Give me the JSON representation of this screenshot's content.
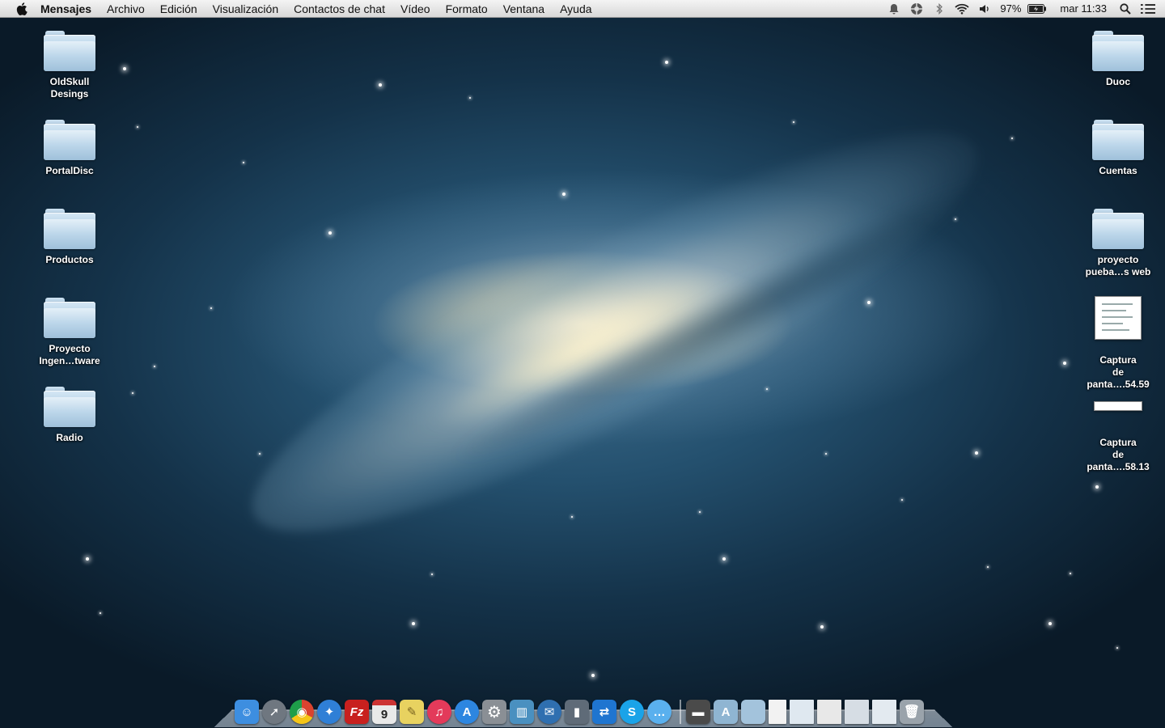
{
  "menubar": {
    "apple_icon": "apple-icon",
    "app_name": "Mensajes",
    "menus": [
      "Archivo",
      "Edición",
      "Visualización",
      "Contactos de chat",
      "Vídeo",
      "Formato",
      "Ventana",
      "Ayuda"
    ],
    "status": {
      "battery_percent": "97%",
      "clock": "mar 11:33"
    }
  },
  "desktop": {
    "left_icons": [
      {
        "label": "OldSkull Desings",
        "type": "folder"
      },
      {
        "label": "PortalDisc",
        "type": "folder"
      },
      {
        "label": "Productos",
        "type": "folder"
      },
      {
        "label": "Proyecto Ingen…tware",
        "type": "folder"
      },
      {
        "label": "Radio",
        "type": "folder"
      }
    ],
    "right_icons": [
      {
        "label": "Duoc",
        "type": "folder"
      },
      {
        "label": "Cuentas",
        "type": "folder"
      },
      {
        "label": "proyecto pueba…s web",
        "type": "folder"
      },
      {
        "label": "Captura de panta….54.59",
        "type": "screenshot"
      },
      {
        "label": "Captura de panta….58.13",
        "type": "screenshot"
      }
    ]
  },
  "dock": {
    "apps": [
      {
        "icon": "finder-icon",
        "glyph": "☺",
        "color": "#3d8ee0"
      },
      {
        "icon": "launchpad-icon",
        "glyph": "➚",
        "color": "#6f7780"
      },
      {
        "icon": "chrome-icon",
        "glyph": "◉",
        "color": "#d9432f"
      },
      {
        "icon": "safari-icon",
        "glyph": "✦",
        "color": "#2f7fd6"
      },
      {
        "icon": "filezilla-icon",
        "glyph": "Fz",
        "color": "#c8201e"
      },
      {
        "icon": "calendar-icon",
        "glyph": "9",
        "color": "#e9e9e9"
      },
      {
        "icon": "stickies-icon",
        "glyph": "✎",
        "color": "#e8d260"
      },
      {
        "icon": "itunes-icon",
        "glyph": "♫",
        "color": "#e33a5a"
      },
      {
        "icon": "app-store-icon",
        "glyph": "A",
        "color": "#2d86e0"
      },
      {
        "icon": "system-preferences-icon",
        "glyph": "⚙",
        "color": "#8a8f95"
      },
      {
        "icon": "sketch-icon",
        "glyph": "▥",
        "color": "#4a90c0"
      },
      {
        "icon": "thunderbird-icon",
        "glyph": "✉",
        "color": "#2f6fb0"
      },
      {
        "icon": "barcode-icon",
        "glyph": "▮",
        "color": "#5f6b78"
      },
      {
        "icon": "teamviewer-icon",
        "glyph": "⇄",
        "color": "#1f75d0"
      },
      {
        "icon": "skype-icon",
        "glyph": "S",
        "color": "#1aa3e8"
      },
      {
        "icon": "messages-icon",
        "glyph": "…",
        "color": "#5ab0ee"
      }
    ],
    "stacks": [
      {
        "icon": "downloads-stack-icon",
        "glyph": "▬",
        "color": "#4a4a4a"
      },
      {
        "icon": "applications-folder-icon",
        "glyph": "A",
        "color": "#8fb5d2"
      },
      {
        "icon": "documents-folder-icon",
        "glyph": "",
        "color": "#a3c3dc"
      },
      {
        "icon": "document-file-icon",
        "glyph": "",
        "color": "#f2f2f2"
      },
      {
        "icon": "screenshot-stack-icon-1",
        "glyph": "",
        "color": "#dfe8f0"
      },
      {
        "icon": "screenshot-stack-icon-2",
        "glyph": "",
        "color": "#e8e8e8"
      },
      {
        "icon": "screenshot-stack-icon-3",
        "glyph": "",
        "color": "#d6dde4"
      },
      {
        "icon": "screenshot-stack-icon-4",
        "glyph": "",
        "color": "#e3eaf0"
      },
      {
        "icon": "trash-icon",
        "glyph": "🗑",
        "color": "#9aa3ab"
      }
    ]
  }
}
